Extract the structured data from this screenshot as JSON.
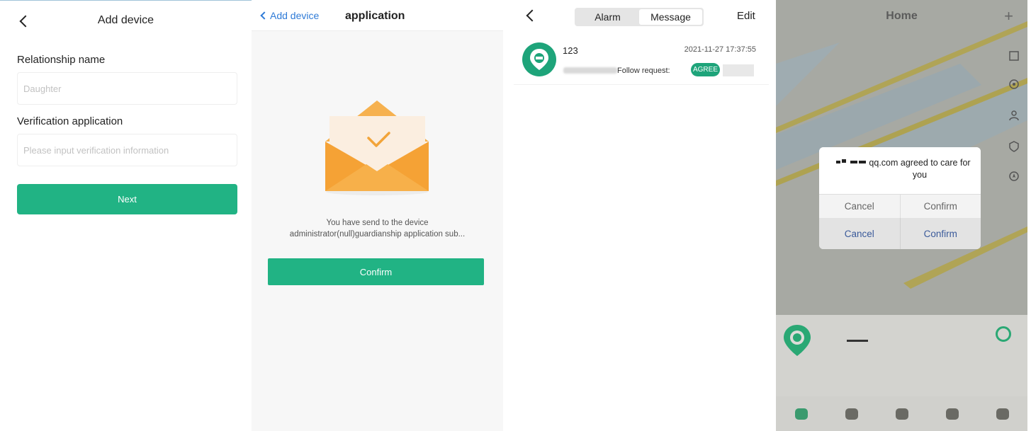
{
  "panel1": {
    "title": "Add device",
    "relationship_label": "Relationship name",
    "relationship_placeholder": "Daughter",
    "verification_label": "Verification application",
    "verification_placeholder": "Please input verification information",
    "next_label": "Next"
  },
  "panel2": {
    "back_label": "Add device",
    "title": "application",
    "message_line1": "You have send to the device",
    "message_line2": "administrator(null)guardianship application sub...",
    "confirm_label": "Confirm"
  },
  "panel3": {
    "tabs": [
      "Alarm",
      "Message"
    ],
    "active_tab": "Message",
    "edit_label": "Edit",
    "message": {
      "name": "123",
      "time": "2021-11-27 17:37:55",
      "text": "Follow request:",
      "agree_label": "AGREE"
    }
  },
  "panel4": {
    "title": "Home",
    "add_icon": "plus-icon",
    "dialog": {
      "text": "qq.com agreed to care for you",
      "row1": [
        "Cancel",
        "Confirm"
      ],
      "row2": [
        "Cancel",
        "Confirm"
      ]
    }
  },
  "colors": {
    "accent": "#21b384",
    "link": "#2f7bd7",
    "envelope": "#f2a43a"
  }
}
